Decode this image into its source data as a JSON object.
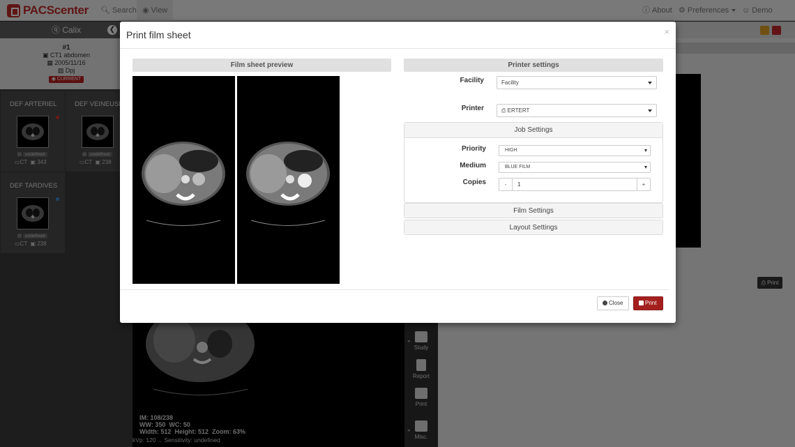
{
  "navbar": {
    "brand": "PACScenter",
    "search": "Search",
    "view": "View",
    "about": "About",
    "preferences": "Preferences",
    "user": "Demo User"
  },
  "sidebar": {
    "patient": "Calix",
    "study": {
      "number": "#1",
      "description": "CT1 abdomen",
      "date": "2005/11/16",
      "author": "Dpj",
      "badge": "CURRENT"
    },
    "series": [
      {
        "title": "DEF ARTERIEL",
        "tag": "undefined",
        "modality": "CT",
        "count": "343",
        "dot": "#d33"
      },
      {
        "title": "DEF VEINEUSE",
        "tag": "undefined",
        "modality": "CT",
        "count": "238",
        "dot": ""
      },
      {
        "title": "DEF TARDIVES",
        "tag": "undefined",
        "modality": "CT",
        "count": "238",
        "dot": "#3a8ee6"
      }
    ]
  },
  "viewer": {
    "im": "IM: 108/238",
    "ww_label": "WW:",
    "ww": "350",
    "wc_label": "WC:",
    "wc": "50",
    "width_label": "Width:",
    "width": "512",
    "height_label": "Height:",
    "height": "512",
    "zoom_label": "Zoom:",
    "zoom": "63%",
    "bottom": "kVp: 120  ... Sensitivity: undefined"
  },
  "tools": {
    "study": "Study",
    "report": "Report",
    "print": "Print",
    "misc": "Misc."
  },
  "right_panel": {
    "print": "Print"
  },
  "modal": {
    "title": "Print film sheet",
    "close_x": "×",
    "preview_header": "Film sheet preview",
    "printer_header": "Printer settings",
    "facility_label": "Facility",
    "facility_value": "Facility",
    "printer_label": "Printer",
    "printer_value": "ERTERT",
    "job_settings": "Job Settings",
    "priority_label": "Priority",
    "priority_value": "HIGH",
    "medium_label": "Medium",
    "medium_value": "BLUE FILM",
    "copies_label": "Copies",
    "copies_minus": "-",
    "copies_value": "1",
    "copies_plus": "+",
    "film_settings": "Film Settings",
    "layout_settings": "Layout Settings",
    "close_button": "Close",
    "print_button": "Print"
  }
}
